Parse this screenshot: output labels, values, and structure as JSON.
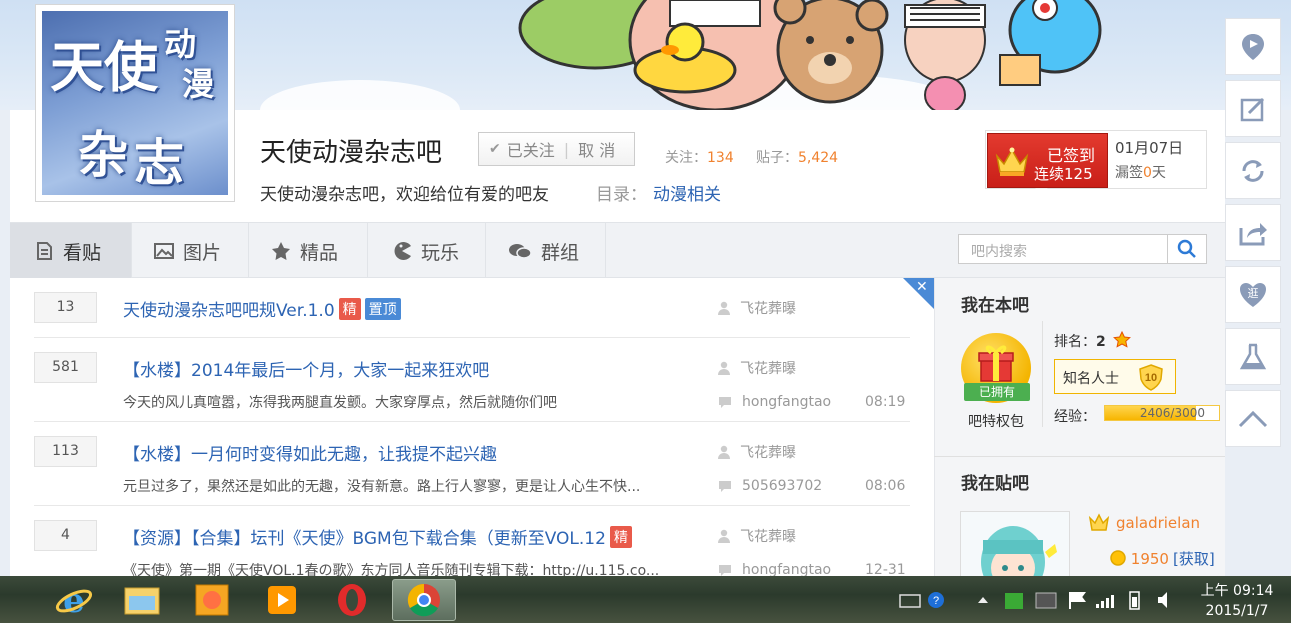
{
  "forum": {
    "name": "天使动漫杂志吧",
    "logo_text": [
      "天使",
      "动",
      "漫",
      "杂",
      "志"
    ],
    "follow_label": "已关注",
    "unfollow_label": "取 消",
    "stats_follow_label": "关注：",
    "stats_follow_value": "134",
    "stats_posts_label": "贴子：",
    "stats_posts_value": "5,424",
    "description": "天使动漫杂志吧，欢迎给位有爱的吧友",
    "catalog_label": "目录：",
    "catalog_value": "动漫相关"
  },
  "signin": {
    "status": "已签到",
    "streak": "连续125天",
    "date": "01月07日",
    "missed_label": "漏签",
    "missed_value": "0",
    "missed_unit": "天"
  },
  "nav": {
    "tabs": [
      {
        "label": "看贴",
        "icon": "document-icon"
      },
      {
        "label": "图片",
        "icon": "image-icon"
      },
      {
        "label": "精品",
        "icon": "star-icon"
      },
      {
        "label": "玩乐",
        "icon": "pacman-icon"
      },
      {
        "label": "群组",
        "icon": "chat-icon"
      }
    ],
    "search_placeholder": "吧内搜索"
  },
  "threads": [
    {
      "replies": "13",
      "title": "天使动漫杂志吧吧规Ver.1.0",
      "badges": [
        "精",
        "置顶"
      ],
      "author": "飞花葬曝",
      "abstract": "",
      "last_replier": "",
      "time": ""
    },
    {
      "replies": "581",
      "title": "【水楼】2014年最后一个月，大家一起来狂欢吧",
      "badges": [],
      "author": "飞花葬曝",
      "abstract": "今天的风儿真喧嚣，冻得我两腿直发颤。大家穿厚点，然后就随你们吧",
      "last_replier": "hongfangtao",
      "time": "08:19"
    },
    {
      "replies": "113",
      "title": "【水楼】一月何时变得如此无趣，让我提不起兴趣",
      "badges": [],
      "author": "飞花葬曝",
      "abstract": "元旦过多了，果然还是如此的无趣，没有新意。路上行人寥寥，更是让人心生不快...",
      "last_replier": "505693702",
      "time": "08:06"
    },
    {
      "replies": "4",
      "title": "【资源】【合集】坛刊《天使》BGM包下载合集（更新至VOL.12",
      "badges": [
        "精"
      ],
      "author": "飞花葬曝",
      "abstract": "《天使》第一期《天使VOL.1春の歌》东方同人音乐随刊专辑下载：http://u.115.co...",
      "last_replier": "hongfangtao",
      "time": "12-31"
    }
  ],
  "sidebar": {
    "my_forum_heading": "我在本吧",
    "privilege_band": "已拥有",
    "privilege_label": "吧特权包",
    "rank_label": "排名：",
    "rank_value": "2",
    "title_badge": "知名人士",
    "level": "10",
    "exp_label": "经验：",
    "exp_text": "2406/3000",
    "exp_fraction": 0.802,
    "my_tieba_heading": "我在贴吧",
    "username": "galadrielan",
    "coins": "1950",
    "coins_action": "[获取]"
  },
  "toolbar": [
    "location-icon",
    "edit-icon",
    "refresh-icon",
    "share-icon",
    "favorite-icon",
    "flask-icon",
    "back-to-top-icon"
  ],
  "favorite_label": "逛",
  "taskbar": {
    "apps": [
      "internet-explorer-icon",
      "file-explorer-icon",
      "photo-app-icon",
      "media-player-icon",
      "opera-icon",
      "chrome-icon"
    ],
    "time": "上午 09:14",
    "date": "2015/1/7"
  }
}
